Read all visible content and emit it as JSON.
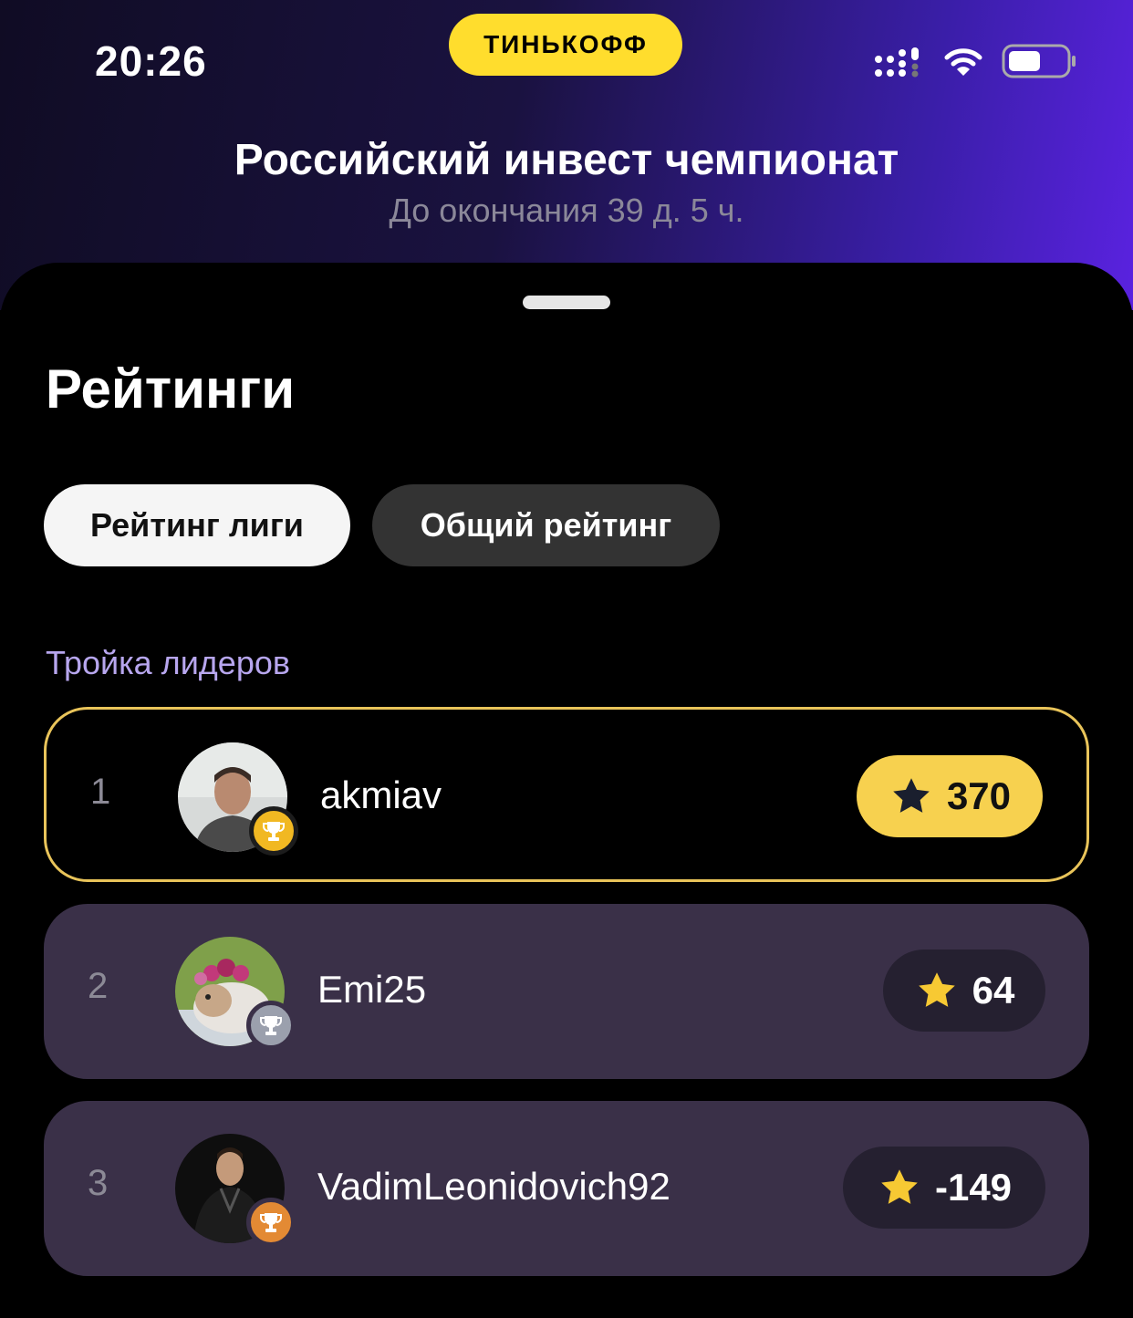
{
  "status_bar": {
    "time": "20:26",
    "brand": "ТИНЬКОФФ"
  },
  "header": {
    "title": "Российский инвест чемпионат",
    "subtitle": "До окончания 39 д. 5 ч."
  },
  "sheet": {
    "title": "Рейтинги",
    "tabs": [
      {
        "label": "Рейтинг лиги",
        "selected": true
      },
      {
        "label": "Общий рейтинг",
        "selected": false
      }
    ],
    "leaders_label": "Тройка лидеров",
    "leaders": [
      {
        "rank": "1",
        "username": "akmiav",
        "score": "370",
        "trophy": "gold"
      },
      {
        "rank": "2",
        "username": "Emi25",
        "score": "64",
        "trophy": "silver"
      },
      {
        "rank": "3",
        "username": "VadimLeonidovich92",
        "score": "-149",
        "trophy": "bronze"
      }
    ]
  },
  "colors": {
    "accent_yellow": "#ffdd2d",
    "leader_border": "#e9c45a",
    "card_bg": "#3a3048",
    "label_purple": "#b7a6ee"
  }
}
